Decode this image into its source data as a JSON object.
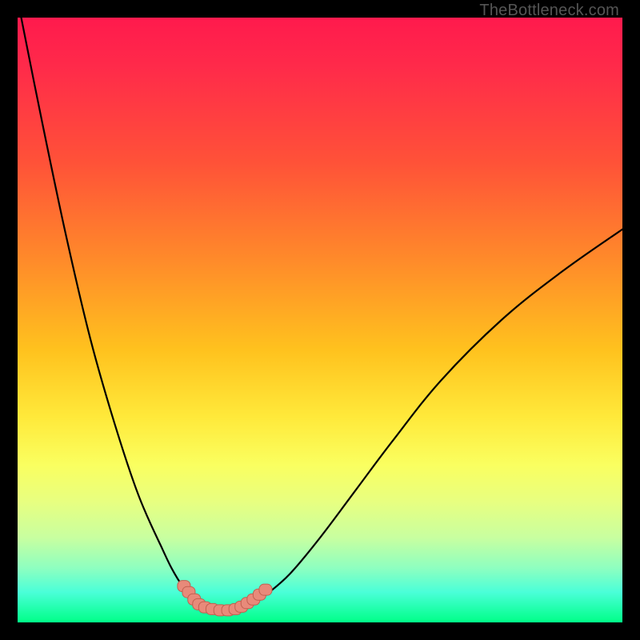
{
  "watermark": "TheBottleneck.com",
  "colors": {
    "frame": "#000000",
    "gradient_top": "#ff1a4d",
    "gradient_bottom": "#00ff88",
    "curve_stroke": "#000000",
    "marker_fill": "#e88a7a",
    "marker_stroke": "#c06050"
  },
  "chart_data": {
    "type": "line",
    "title": "",
    "xlabel": "",
    "ylabel": "",
    "xlim": [
      0,
      100
    ],
    "ylim": [
      0,
      100
    ],
    "series": [
      {
        "name": "bottleneck-curve",
        "x": [
          0,
          4,
          8,
          12,
          16,
          20,
          24,
          26,
          28,
          29.5,
          31,
          33,
          35,
          37,
          39,
          41,
          45,
          50,
          56,
          62,
          70,
          80,
          90,
          100
        ],
        "y": [
          103,
          83,
          64,
          47,
          33,
          21,
          12,
          8,
          5,
          3.5,
          2.5,
          2,
          2,
          2.2,
          3,
          4.5,
          8,
          14,
          22,
          30,
          40,
          50,
          58,
          65
        ]
      }
    ],
    "markers": {
      "name": "highlight-band",
      "points": [
        {
          "x": 27.5,
          "y": 6.0
        },
        {
          "x": 28.3,
          "y": 5.0
        },
        {
          "x": 29.2,
          "y": 3.8
        },
        {
          "x": 30.0,
          "y": 3.0
        },
        {
          "x": 31.0,
          "y": 2.5
        },
        {
          "x": 32.2,
          "y": 2.2
        },
        {
          "x": 33.5,
          "y": 2.0
        },
        {
          "x": 34.8,
          "y": 2.0
        },
        {
          "x": 36.0,
          "y": 2.2
        },
        {
          "x": 37.0,
          "y": 2.6
        },
        {
          "x": 38.0,
          "y": 3.2
        },
        {
          "x": 39.0,
          "y": 3.8
        },
        {
          "x": 40.0,
          "y": 4.6
        },
        {
          "x": 41.0,
          "y": 5.4
        }
      ]
    }
  }
}
